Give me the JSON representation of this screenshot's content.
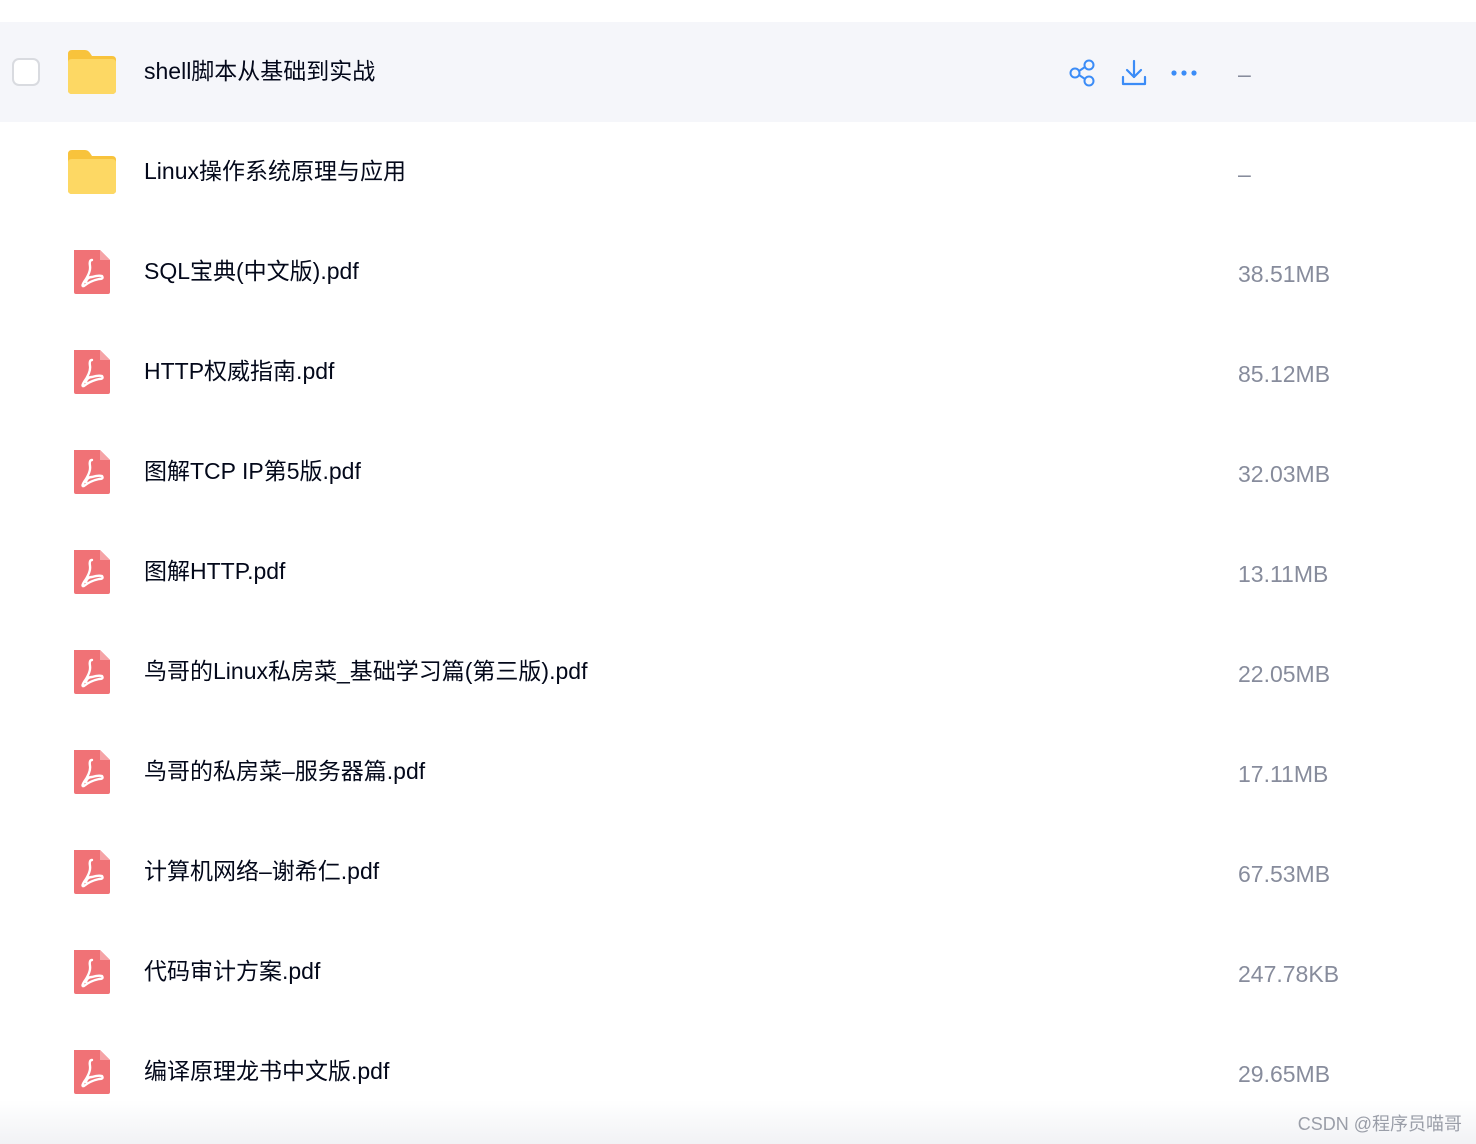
{
  "colors": {
    "folder": "#fcd34d",
    "pdf": "#f07276",
    "action_icon": "#3b8cf7",
    "size_text": "#878c9c",
    "hover_bg": "#f5f6fa"
  },
  "rows": [
    {
      "name": "shell脚本从基础到实战",
      "size": "–",
      "type": "folder",
      "icon": "folder-icon",
      "hovered": true
    },
    {
      "name": "Linux操作系统原理与应用",
      "size": "–",
      "type": "folder",
      "icon": "folder-icon",
      "hovered": false
    },
    {
      "name": "SQL宝典(中文版).pdf",
      "size": "38.51MB",
      "type": "pdf",
      "icon": "pdf-icon",
      "hovered": false
    },
    {
      "name": "HTTP权威指南.pdf",
      "size": "85.12MB",
      "type": "pdf",
      "icon": "pdf-icon",
      "hovered": false
    },
    {
      "name": "图解TCP IP第5版.pdf",
      "size": "32.03MB",
      "type": "pdf",
      "icon": "pdf-icon",
      "hovered": false
    },
    {
      "name": "图解HTTP.pdf",
      "size": "13.11MB",
      "type": "pdf",
      "icon": "pdf-icon",
      "hovered": false
    },
    {
      "name": "鸟哥的Linux私房菜_基础学习篇(第三版).pdf",
      "size": "22.05MB",
      "type": "pdf",
      "icon": "pdf-icon",
      "hovered": false
    },
    {
      "name": "鸟哥的私房菜–服务器篇.pdf",
      "size": "17.11MB",
      "type": "pdf",
      "icon": "pdf-icon",
      "hovered": false
    },
    {
      "name": "计算机网络–谢希仁.pdf",
      "size": "67.53MB",
      "type": "pdf",
      "icon": "pdf-icon",
      "hovered": false
    },
    {
      "name": "代码审计方案.pdf",
      "size": "247.78KB",
      "type": "pdf",
      "icon": "pdf-icon",
      "hovered": false
    },
    {
      "name": "编译原理龙书中文版.pdf",
      "size": "29.65MB",
      "type": "pdf",
      "icon": "pdf-icon",
      "hovered": false
    }
  ],
  "hover_actions": [
    {
      "icon": "share-icon"
    },
    {
      "icon": "download-icon"
    },
    {
      "icon": "more-icon"
    }
  ],
  "watermark": "CSDN @程序员喵哥"
}
